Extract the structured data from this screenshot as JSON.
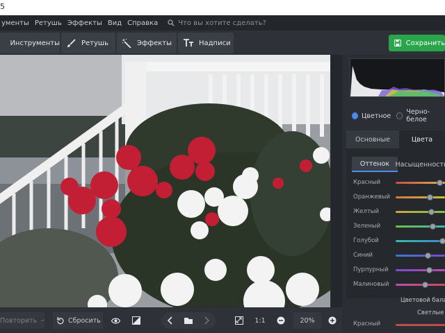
{
  "window": {
    "title_fragment": "5"
  },
  "menu": {
    "items": [
      "ументы",
      "Ретушь",
      "Эффекты",
      "Вид",
      "Справка"
    ],
    "search_placeholder": "Что вы хотите сделать?"
  },
  "toolbar": {
    "tools": [
      "Инструменты",
      "Ретушь",
      "Эффекты",
      "Надписи"
    ],
    "save_label": "Сохранить"
  },
  "panel": {
    "mode_color": "Цветное",
    "mode_bw": "Черно-белое",
    "tab_basic": "Основные",
    "tab_colors": "Цвета",
    "subtab_hue": "Оттенок",
    "subtab_saturation": "Насыщенность",
    "sliders": [
      {
        "label": "Красный",
        "value": 0.9,
        "gradient": [
          "#d04a4a",
          "#d6b24a"
        ]
      },
      {
        "label": "Оранжевый",
        "value": 0.7,
        "gradient": [
          "#d07a3a",
          "#c8c046"
        ]
      },
      {
        "label": "Желтый",
        "value": 0.72,
        "gradient": [
          "#d0a43a",
          "#7cc446"
        ]
      },
      {
        "label": "Зеленый",
        "value": 0.76,
        "gradient": [
          "#6fc04a",
          "#3ab8a8"
        ]
      },
      {
        "label": "Голубой",
        "value": 0.95,
        "gradient": [
          "#3ab8a8",
          "#3a8ad0"
        ]
      },
      {
        "label": "Синий",
        "value": 0.66,
        "gradient": [
          "#3a7ad0",
          "#7a4ad0"
        ]
      },
      {
        "label": "Пурпурный",
        "value": 0.68,
        "gradient": [
          "#7a4ad0",
          "#c04ab0"
        ]
      },
      {
        "label": "Малиновый",
        "value": 0.6,
        "gradient": [
          "#c04ab0",
          "#d04a5a"
        ]
      }
    ],
    "balance_label": "Цветовой бала",
    "light_label": "Светлые",
    "red_label2": "Красный"
  },
  "bottom": {
    "redo_label": "Повторить",
    "reset_label": "Сбросить",
    "one_to_one": "1:1",
    "zoom": "20%"
  },
  "colors": {
    "accent": "#4d8ef0",
    "save": "#2aa64a"
  }
}
